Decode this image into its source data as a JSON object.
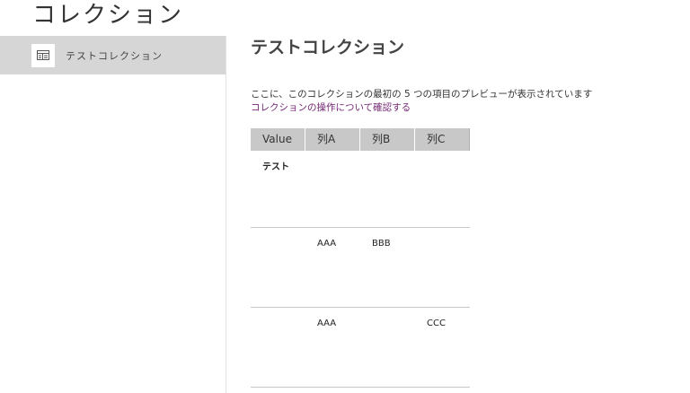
{
  "page": {
    "title": "コレクション"
  },
  "sidebar": {
    "items": [
      {
        "label": "テストコレクション",
        "icon": "table-icon",
        "selected": true
      }
    ]
  },
  "main": {
    "collection_title": "テストコレクション",
    "description": "ここに、このコレクションの最初の 5 つの項目のプレビューが表示されています",
    "learn_link": "コレクションの操作について確認する",
    "table": {
      "columns": [
        "Value",
        "列A",
        "列B",
        "列C"
      ],
      "rows": [
        [
          "テスト",
          "",
          "",
          ""
        ],
        [
          "",
          "AAA",
          "BBB",
          ""
        ],
        [
          "",
          "AAA",
          "",
          "CCC"
        ]
      ]
    }
  },
  "colors": {
    "selected_bg": "#d6d6d6",
    "link": "#742774",
    "header_bg": "#c8c8c8"
  }
}
